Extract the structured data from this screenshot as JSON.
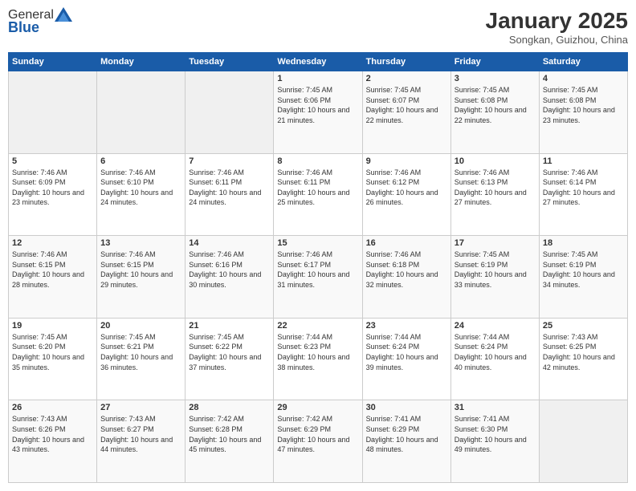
{
  "header": {
    "logo_general": "General",
    "logo_blue": "Blue",
    "month_title": "January 2025",
    "location": "Songkan, Guizhou, China"
  },
  "weekdays": [
    "Sunday",
    "Monday",
    "Tuesday",
    "Wednesday",
    "Thursday",
    "Friday",
    "Saturday"
  ],
  "weeks": [
    [
      {
        "day": "",
        "empty": true
      },
      {
        "day": "",
        "empty": true
      },
      {
        "day": "",
        "empty": true
      },
      {
        "day": "1",
        "sunrise": "7:45 AM",
        "sunset": "6:06 PM",
        "daylight": "10 hours and 21 minutes."
      },
      {
        "day": "2",
        "sunrise": "7:45 AM",
        "sunset": "6:07 PM",
        "daylight": "10 hours and 22 minutes."
      },
      {
        "day": "3",
        "sunrise": "7:45 AM",
        "sunset": "6:08 PM",
        "daylight": "10 hours and 22 minutes."
      },
      {
        "day": "4",
        "sunrise": "7:45 AM",
        "sunset": "6:08 PM",
        "daylight": "10 hours and 23 minutes."
      }
    ],
    [
      {
        "day": "5",
        "sunrise": "7:46 AM",
        "sunset": "6:09 PM",
        "daylight": "10 hours and 23 minutes."
      },
      {
        "day": "6",
        "sunrise": "7:46 AM",
        "sunset": "6:10 PM",
        "daylight": "10 hours and 24 minutes."
      },
      {
        "day": "7",
        "sunrise": "7:46 AM",
        "sunset": "6:11 PM",
        "daylight": "10 hours and 24 minutes."
      },
      {
        "day": "8",
        "sunrise": "7:46 AM",
        "sunset": "6:11 PM",
        "daylight": "10 hours and 25 minutes."
      },
      {
        "day": "9",
        "sunrise": "7:46 AM",
        "sunset": "6:12 PM",
        "daylight": "10 hours and 26 minutes."
      },
      {
        "day": "10",
        "sunrise": "7:46 AM",
        "sunset": "6:13 PM",
        "daylight": "10 hours and 27 minutes."
      },
      {
        "day": "11",
        "sunrise": "7:46 AM",
        "sunset": "6:14 PM",
        "daylight": "10 hours and 27 minutes."
      }
    ],
    [
      {
        "day": "12",
        "sunrise": "7:46 AM",
        "sunset": "6:15 PM",
        "daylight": "10 hours and 28 minutes."
      },
      {
        "day": "13",
        "sunrise": "7:46 AM",
        "sunset": "6:15 PM",
        "daylight": "10 hours and 29 minutes."
      },
      {
        "day": "14",
        "sunrise": "7:46 AM",
        "sunset": "6:16 PM",
        "daylight": "10 hours and 30 minutes."
      },
      {
        "day": "15",
        "sunrise": "7:46 AM",
        "sunset": "6:17 PM",
        "daylight": "10 hours and 31 minutes."
      },
      {
        "day": "16",
        "sunrise": "7:46 AM",
        "sunset": "6:18 PM",
        "daylight": "10 hours and 32 minutes."
      },
      {
        "day": "17",
        "sunrise": "7:45 AM",
        "sunset": "6:19 PM",
        "daylight": "10 hours and 33 minutes."
      },
      {
        "day": "18",
        "sunrise": "7:45 AM",
        "sunset": "6:19 PM",
        "daylight": "10 hours and 34 minutes."
      }
    ],
    [
      {
        "day": "19",
        "sunrise": "7:45 AM",
        "sunset": "6:20 PM",
        "daylight": "10 hours and 35 minutes."
      },
      {
        "day": "20",
        "sunrise": "7:45 AM",
        "sunset": "6:21 PM",
        "daylight": "10 hours and 36 minutes."
      },
      {
        "day": "21",
        "sunrise": "7:45 AM",
        "sunset": "6:22 PM",
        "daylight": "10 hours and 37 minutes."
      },
      {
        "day": "22",
        "sunrise": "7:44 AM",
        "sunset": "6:23 PM",
        "daylight": "10 hours and 38 minutes."
      },
      {
        "day": "23",
        "sunrise": "7:44 AM",
        "sunset": "6:24 PM",
        "daylight": "10 hours and 39 minutes."
      },
      {
        "day": "24",
        "sunrise": "7:44 AM",
        "sunset": "6:24 PM",
        "daylight": "10 hours and 40 minutes."
      },
      {
        "day": "25",
        "sunrise": "7:43 AM",
        "sunset": "6:25 PM",
        "daylight": "10 hours and 42 minutes."
      }
    ],
    [
      {
        "day": "26",
        "sunrise": "7:43 AM",
        "sunset": "6:26 PM",
        "daylight": "10 hours and 43 minutes."
      },
      {
        "day": "27",
        "sunrise": "7:43 AM",
        "sunset": "6:27 PM",
        "daylight": "10 hours and 44 minutes."
      },
      {
        "day": "28",
        "sunrise": "7:42 AM",
        "sunset": "6:28 PM",
        "daylight": "10 hours and 45 minutes."
      },
      {
        "day": "29",
        "sunrise": "7:42 AM",
        "sunset": "6:29 PM",
        "daylight": "10 hours and 47 minutes."
      },
      {
        "day": "30",
        "sunrise": "7:41 AM",
        "sunset": "6:29 PM",
        "daylight": "10 hours and 48 minutes."
      },
      {
        "day": "31",
        "sunrise": "7:41 AM",
        "sunset": "6:30 PM",
        "daylight": "10 hours and 49 minutes."
      },
      {
        "day": "",
        "empty": true
      }
    ]
  ]
}
